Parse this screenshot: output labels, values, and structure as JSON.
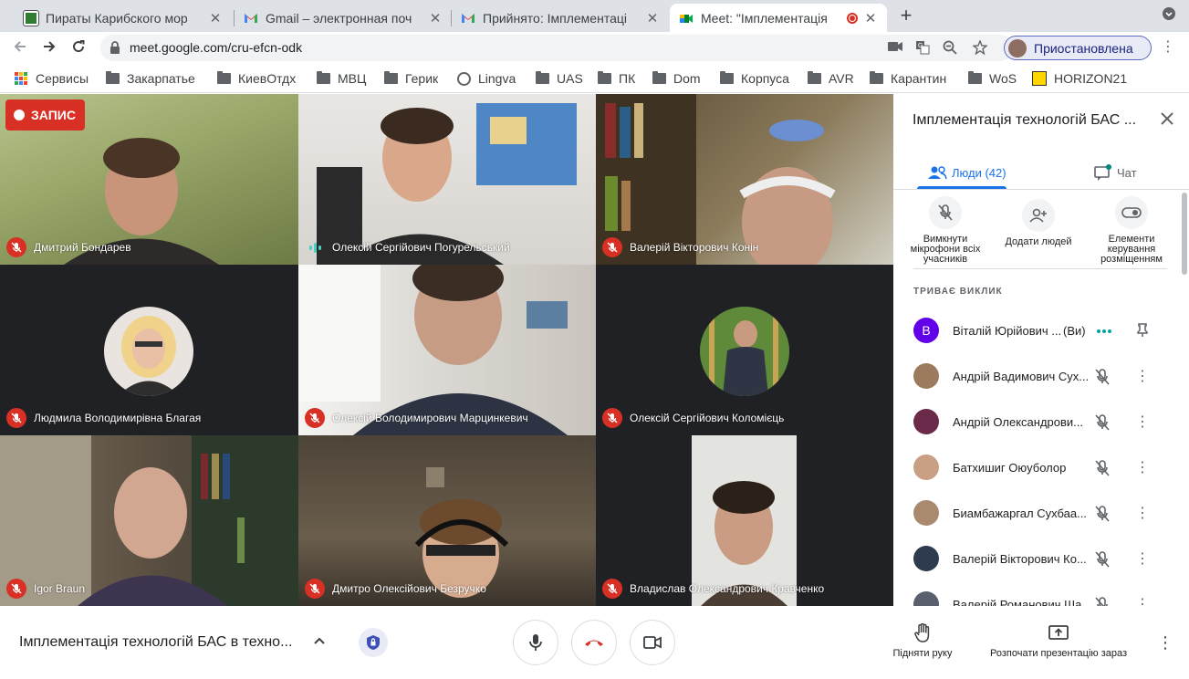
{
  "browser": {
    "tabs": [
      {
        "title": "Пираты Карибского мор"
      },
      {
        "title": "Gmail – электронная поч"
      },
      {
        "title": "Прийнято: Імплементаці"
      },
      {
        "title": "Meet: \"Імплементація"
      }
    ],
    "new_tab": "+",
    "url": "meet.google.com/cru-efcn-odk",
    "profile_label": "Приостановлена"
  },
  "bookmarks": [
    {
      "label": "Сервисы",
      "icon": "apps-icon"
    },
    {
      "label": "Закарпатье",
      "icon": "folder-icon"
    },
    {
      "label": "КиевОтдх",
      "icon": "folder-icon"
    },
    {
      "label": "МВЦ",
      "icon": "folder-icon"
    },
    {
      "label": "Герик",
      "icon": "folder-icon"
    },
    {
      "label": "Lingva",
      "icon": "globe-icon"
    },
    {
      "label": "UAS",
      "icon": "folder-icon"
    },
    {
      "label": "ПК",
      "icon": "folder-icon"
    },
    {
      "label": "Dom",
      "icon": "folder-icon"
    },
    {
      "label": "Корпуса",
      "icon": "folder-icon"
    },
    {
      "label": "AVR",
      "icon": "folder-icon"
    },
    {
      "label": "Карантин",
      "icon": "folder-icon"
    },
    {
      "label": "WoS",
      "icon": "folder-icon"
    },
    {
      "label": "HORIZON21",
      "icon": "horizon-icon"
    }
  ],
  "recording_label": "ЗАПИС",
  "tiles": [
    {
      "name": "Дмитрий Бондарев",
      "status": "muted"
    },
    {
      "name": "Олексій Сергійович Погурельський",
      "status": "speaking"
    },
    {
      "name": "Валерій Вікторович Конін",
      "status": "muted"
    },
    {
      "name": "Людмила Володимирівна Благая",
      "status": "muted"
    },
    {
      "name": "Олексій Володимирович Марцинкевич",
      "status": "muted"
    },
    {
      "name": "Олексій Сергійович Коломієць",
      "status": "muted"
    },
    {
      "name": "Igor Braun",
      "status": "muted"
    },
    {
      "name": "Дмитро Олексійович Безручко",
      "status": "muted"
    },
    {
      "name": "Владислав Олександрович Кравченко",
      "status": "muted"
    }
  ],
  "panel": {
    "title": "Імплементація технологій БАС ...",
    "tab_people": "Люди (42)",
    "tab_chat": "Чат",
    "actions": [
      {
        "label": "Вимкнути мікрофони всіх учасників"
      },
      {
        "label": "Додати людей"
      },
      {
        "label": "Елементи керування розміщенням"
      }
    ],
    "section_heading": "ТРИВАЄ ВИКЛИК",
    "participants": [
      {
        "name": "Віталій Юрійович ...",
        "you": "(Ви)",
        "avatar_letter": "В"
      },
      {
        "name": "Андрій Вадимович Сух..."
      },
      {
        "name": "Андрій Олександрови..."
      },
      {
        "name": "Батхишиг Оюуболор"
      },
      {
        "name": "Биамбажаргал Сухбаа..."
      },
      {
        "name": "Валерій Вікторович Ко..."
      },
      {
        "name": "Валерій Романович Ша..."
      }
    ]
  },
  "bottom": {
    "meeting_title": "Імплементація технологій БАС в техно...",
    "raise_hand": "Підняти руку",
    "present_now": "Розпочати презентацію зараз"
  }
}
